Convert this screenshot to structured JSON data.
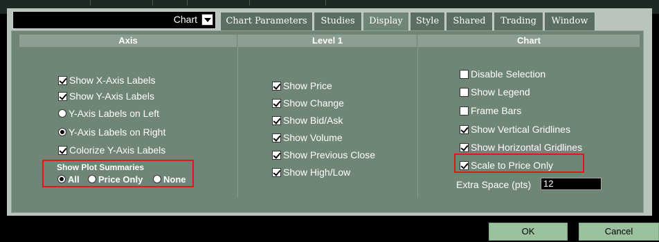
{
  "selector": {
    "value": "Chart"
  },
  "tabs": [
    {
      "label": "Chart Parameters"
    },
    {
      "label": "Studies"
    },
    {
      "label": "Display"
    },
    {
      "label": "Style"
    },
    {
      "label": "Shared"
    },
    {
      "label": "Trading"
    },
    {
      "label": "Window"
    }
  ],
  "active_tab": "Display",
  "columns": {
    "axis": {
      "title": "Axis",
      "options": [
        {
          "label": "Show X-Axis Labels",
          "type": "checkbox",
          "checked": true
        },
        {
          "label": "Show Y-Axis Labels",
          "type": "checkbox",
          "checked": true
        },
        {
          "label": "Y-Axis Labels on Left",
          "type": "radio",
          "checked": false
        },
        {
          "label": "Y-Axis Labels on Right",
          "type": "radio",
          "checked": true
        },
        {
          "label": "Colorize Y-Axis Labels",
          "type": "checkbox",
          "checked": true
        }
      ],
      "plot_summaries": {
        "title": "Show Plot Summaries",
        "options": [
          {
            "label": "All",
            "checked": true
          },
          {
            "label": "Price Only",
            "checked": false
          },
          {
            "label": "None",
            "checked": false
          }
        ]
      }
    },
    "level1": {
      "title": "Level 1",
      "options": [
        {
          "label": "Show Price",
          "checked": true
        },
        {
          "label": "Show Change",
          "checked": true
        },
        {
          "label": "Show Bid/Ask",
          "checked": true
        },
        {
          "label": "Show Volume",
          "checked": true
        },
        {
          "label": "Show Previous Close",
          "checked": true
        },
        {
          "label": "Show High/Low",
          "checked": true
        }
      ]
    },
    "chart": {
      "title": "Chart",
      "options": [
        {
          "label": "Disable Selection",
          "checked": false
        },
        {
          "label": "Show Legend",
          "checked": false
        },
        {
          "label": "Frame Bars",
          "checked": false
        },
        {
          "label": "Show Vertical Gridlines",
          "checked": true
        },
        {
          "label": "Show Horizontal Gridlines",
          "checked": true
        },
        {
          "label": "Scale to Price Only",
          "checked": true
        }
      ],
      "extra_space": {
        "label": "Extra Space (pts)",
        "value": "12"
      }
    }
  },
  "buttons": {
    "ok": "OK",
    "cancel": "Cancel"
  },
  "colors": {
    "panel": "#6f8575",
    "header": "#8d9e92",
    "highlight": "#e01818",
    "button": "#9bc29f"
  }
}
